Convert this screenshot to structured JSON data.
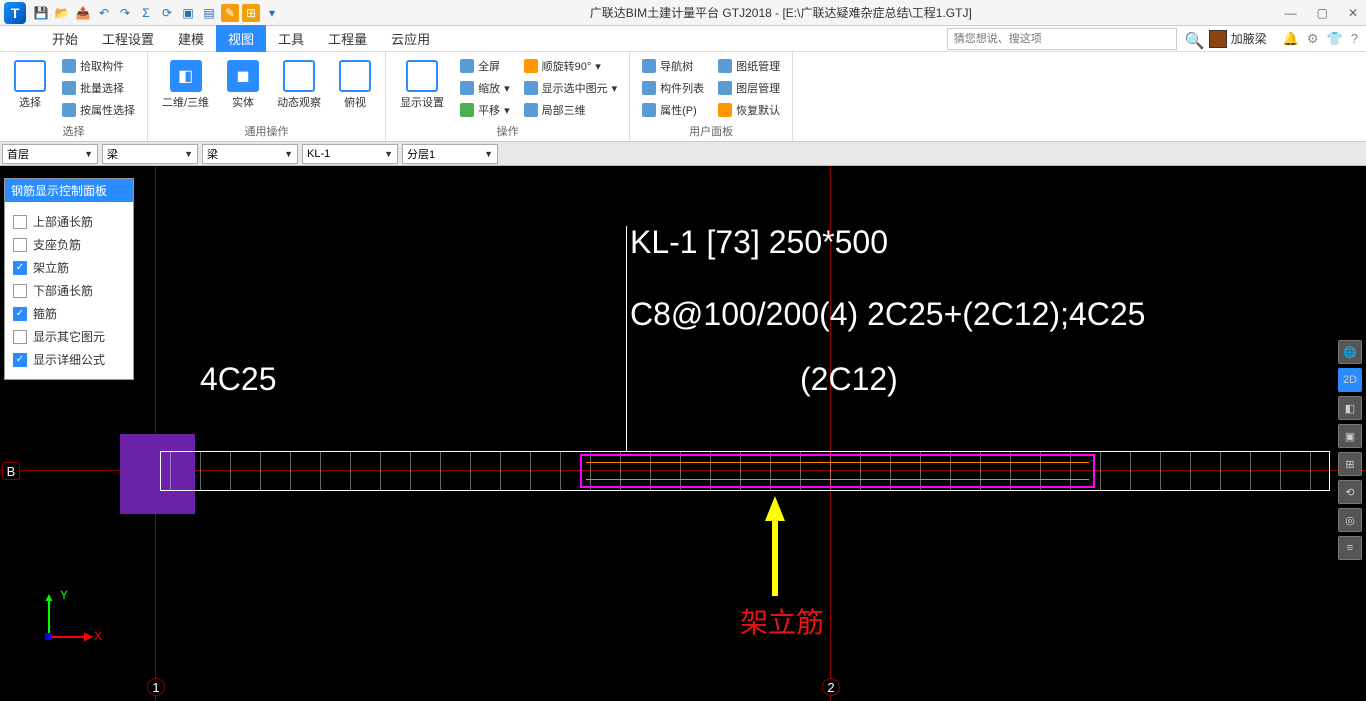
{
  "titlebar": {
    "app_logo": "T",
    "title": "广联达BIM土建计量平台 GTJ2018 - [E:\\广联达疑难杂症总结\\工程1.GTJ]",
    "user_name": "加腋梁"
  },
  "menu": {
    "tabs": [
      "开始",
      "工程设置",
      "建模",
      "视图",
      "工具",
      "工程量",
      "云应用"
    ],
    "active": "视图"
  },
  "ribbon": {
    "group1_label": "选择",
    "select_big": "选择",
    "pick_component": "拾取构件",
    "batch_select": "批量选择",
    "by_attr_select": "按属性选择",
    "group2_label": "通用操作",
    "btn_2d3d": "二维/三维",
    "btn_solid": "实体",
    "btn_dynamic": "动态观察",
    "btn_iso": "俯视",
    "group3_label": "操作",
    "display_settings": "显示设置",
    "fullscreen": "全屏",
    "zoom": "缩放",
    "pan": "平移",
    "rotate90": "顺旋转90°",
    "show_selected": "显示选中图元",
    "local_3d": "局部三维",
    "group4_label": "用户面板",
    "nav_tree": "导航树",
    "component_list": "构件列表",
    "properties": "属性(P)",
    "drawing_mgr": "图纸管理",
    "layer_mgr": "图层管理",
    "restore_default": "恢复默认"
  },
  "search": {
    "placeholder": "猜您想说、搜这项"
  },
  "selectors": {
    "floor": "首层",
    "cat1": "梁",
    "cat2": "梁",
    "element": "KL-1",
    "layer": "分层1"
  },
  "side_panel": {
    "title": "钢筋显示控制面板",
    "items": [
      {
        "label": "上部通长筋",
        "checked": false
      },
      {
        "label": "支座负筋",
        "checked": false
      },
      {
        "label": "架立筋",
        "checked": true
      },
      {
        "label": "下部通长筋",
        "checked": false
      },
      {
        "label": "箍筋",
        "checked": true
      },
      {
        "label": "显示其它图元",
        "checked": false
      },
      {
        "label": "显示详细公式",
        "checked": true
      }
    ]
  },
  "canvas": {
    "text_4c25": "4C25",
    "kl_line1": "KL-1 [73] 250*500",
    "kl_line2": "C8@100/200(4) 2C25+(2C12);4C25",
    "kl_line3": "(2C12)",
    "red_label": "架立筋",
    "axis_b": "B",
    "axis_1": "1",
    "axis_2": "2",
    "coord_y": "Y",
    "coord_x": "X"
  }
}
